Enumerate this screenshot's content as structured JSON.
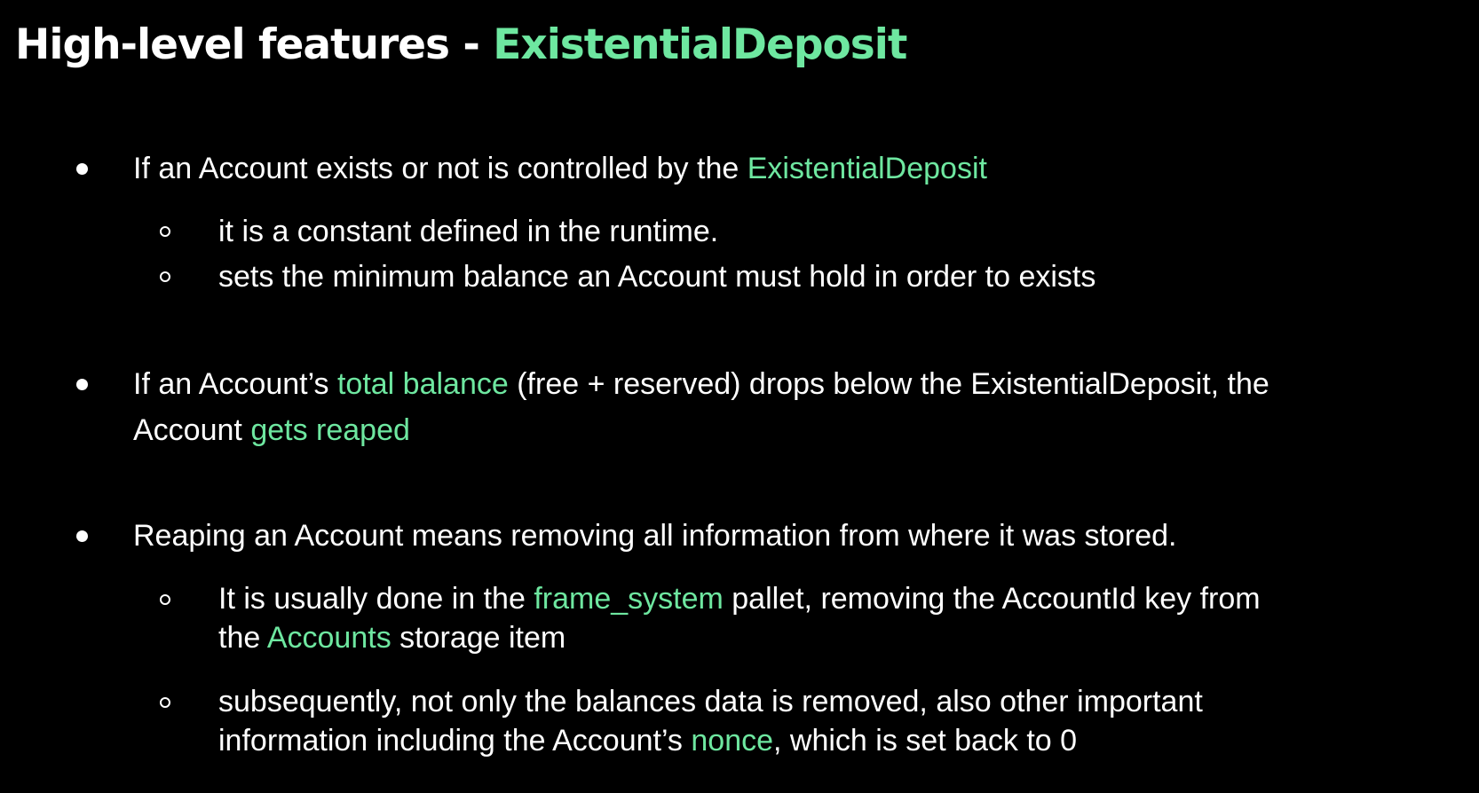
{
  "title": {
    "prefix": "High-level features - ",
    "accent": "ExistentialDeposit"
  },
  "colors": {
    "background": "#000000",
    "text": "#ffffff",
    "accent": "#6ee7a0"
  },
  "bullets": [
    {
      "text_a": "If an Account exists or not is controlled by the ",
      "accent_a": "ExistentialDeposit",
      "sub": [
        {
          "text": "it is a constant defined in the runtime."
        },
        {
          "text": "sets the minimum balance an Account must hold in order to exists"
        }
      ]
    },
    {
      "text_a": "If an Account’s ",
      "accent_a": "total balance",
      "text_b": " (free + reserved) drops below the ExistentialDeposit, the",
      "line2_text": "Account ",
      "line2_accent": "gets reaped"
    },
    {
      "text_a": "Reaping an Account means removing all information from where it was stored.",
      "sub": [
        {
          "text_a": "It is usually done in the ",
          "accent_a": "frame_system",
          "text_b": " pallet, removing the AccountId key from",
          "line2_text_a": "the ",
          "line2_accent": "Accounts",
          "line2_text_b": " storage item"
        },
        {
          "text_a": "subsequently, not only the balances data is removed, also other important",
          "line2_text_a": "information including the Account’s ",
          "line2_accent": "nonce",
          "line2_text_b": ", which is set back to 0"
        }
      ]
    }
  ]
}
